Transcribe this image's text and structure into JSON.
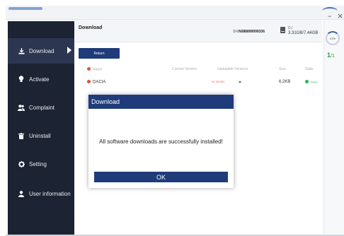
{
  "window": {
    "minimize_glyph": "–",
    "close_glyph": "×"
  },
  "sidebar": {
    "items": [
      {
        "label": "Download",
        "icon": "download-icon",
        "active": true
      },
      {
        "label": "Activate",
        "icon": "bulb-icon"
      },
      {
        "label": "Complaint",
        "icon": "people-icon"
      },
      {
        "label": "Uninstall",
        "icon": "trash-icon"
      },
      {
        "label": "Setting",
        "icon": "gear-icon"
      },
      {
        "label": "User information",
        "icon": "user-icon"
      }
    ]
  },
  "header": {
    "title": "Download",
    "sn_label": "SN:",
    "sn_value": "N088899999336",
    "disk_name": "D:/",
    "disk_usage": "3.31GB/7.44GB"
  },
  "toolbar": {
    "return_label": "Return"
  },
  "table": {
    "headers": [
      "Name",
      "Current Version",
      "Updatable Versions",
      "Size",
      "State"
    ],
    "rows": [
      {
        "name": "DACIA",
        "current_version": "",
        "updatable_version": "V1.30.001",
        "size": "6.2KB",
        "state": "Done"
      }
    ]
  },
  "rail": {
    "percent": "47%",
    "page_current": "1",
    "page_total": "/1"
  },
  "dialog": {
    "title": "Download",
    "message": "All software downloads are successfully installed!",
    "ok_label": "OK"
  },
  "colors": {
    "sidebar_bg": "#1c2333",
    "accent": "#1f3b7a",
    "status_red": "#e0533d",
    "status_green": "#2db34a"
  }
}
